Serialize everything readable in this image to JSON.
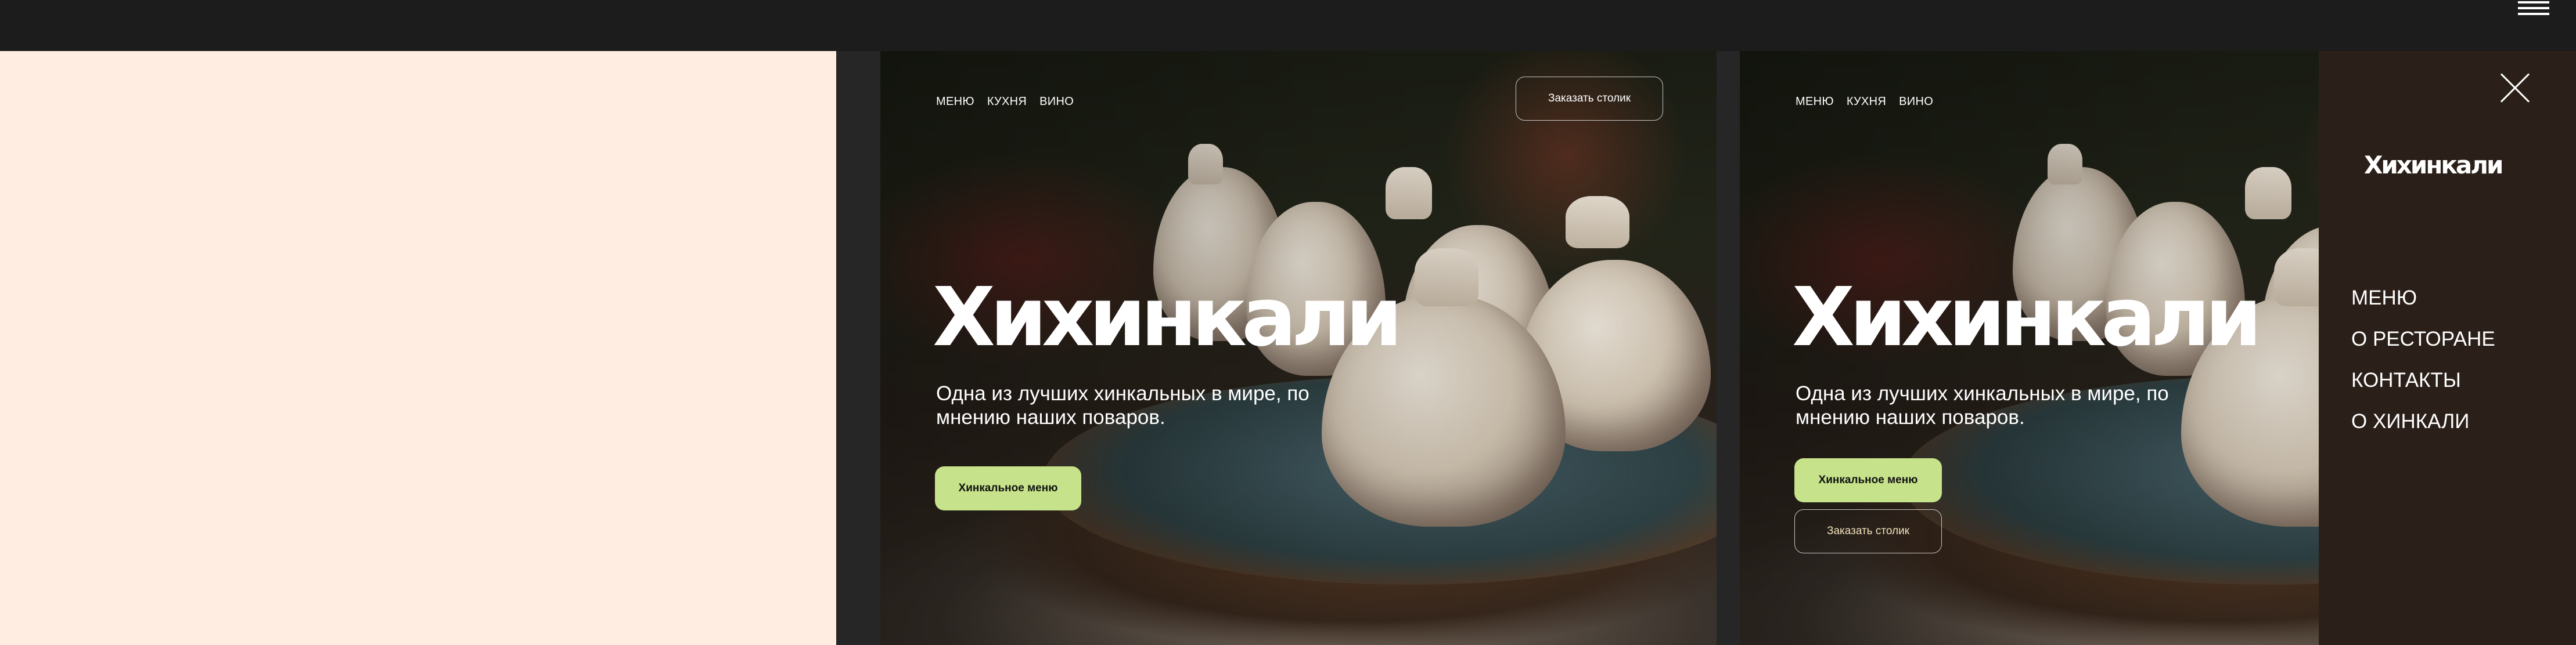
{
  "nav": [
    "МЕНЮ",
    "КУХНЯ",
    "ВИНО"
  ],
  "reserve_label": "Заказать столик",
  "hero": {
    "title": "Хихинкали",
    "subtitle": "Одна из лучших хинкальных в мире, по мнению наших поваров.",
    "menu_button": "Хинкальное меню"
  },
  "side_menu": {
    "logo": "Хихинкали",
    "links": [
      "МЕНЮ",
      "О РЕСТОРАНЕ",
      "КОНТАКТЫ",
      "О ХИНКАЛИ"
    ]
  },
  "colors": {
    "accent_green": "#c6e28a",
    "peach": "#ffede1",
    "panel_brown": "#2b2019",
    "topbar": "#1c1c1c"
  },
  "icons": {
    "hamburger": "hamburger-menu-icon",
    "close": "close-icon"
  }
}
